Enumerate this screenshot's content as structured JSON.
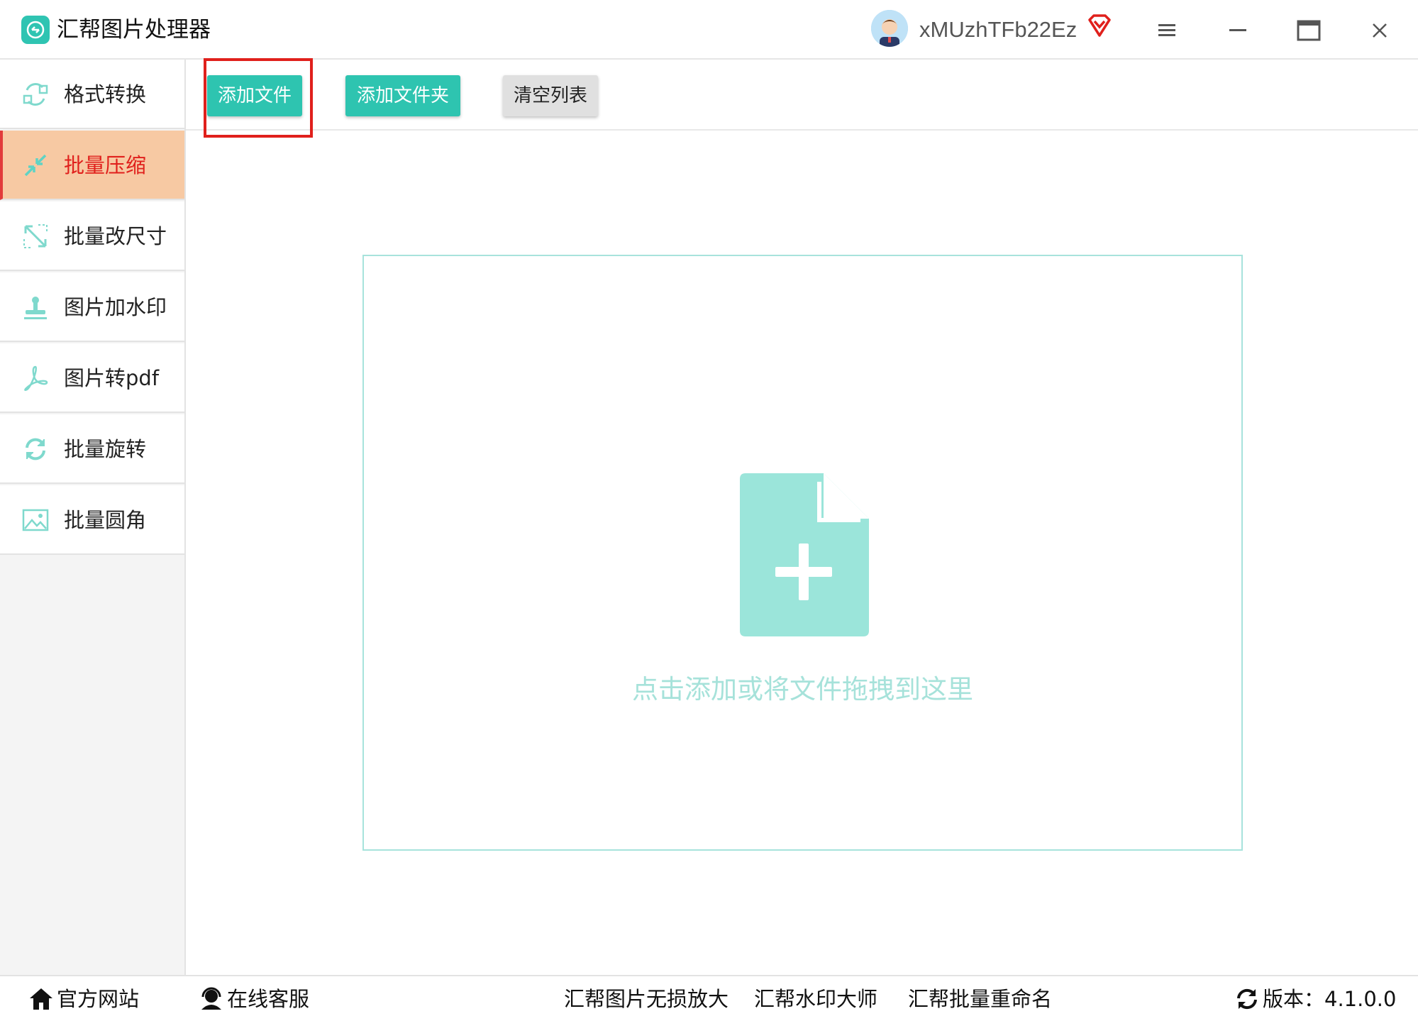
{
  "app": {
    "title": "汇帮图片处理器",
    "username": "xMUzhTFb22Ez"
  },
  "sidebar": {
    "items": [
      {
        "label": "格式转换",
        "icon": "format-convert-icon"
      },
      {
        "label": "批量压缩",
        "icon": "compress-icon",
        "active": true
      },
      {
        "label": "批量改尺寸",
        "icon": "resize-icon"
      },
      {
        "label": "图片加水印",
        "icon": "watermark-icon"
      },
      {
        "label": "图片转pdf",
        "icon": "pdf-icon"
      },
      {
        "label": "批量旋转",
        "icon": "rotate-icon"
      },
      {
        "label": "批量圆角",
        "icon": "round-corner-icon"
      }
    ]
  },
  "toolbar": {
    "add_file": "添加文件",
    "add_folder": "添加文件夹",
    "clear_list": "清空列表"
  },
  "dropzone": {
    "text": "点击添加或将文件拖拽到这里"
  },
  "footer": {
    "website": "官方网站",
    "support": "在线客服",
    "links": [
      "汇帮图片无损放大",
      "汇帮水印大师",
      "汇帮批量重命名"
    ],
    "version": "版本：4.1.0.0"
  },
  "colors": {
    "accent": "#2ec4b0",
    "active_bg": "#f7c9a3",
    "active_text": "#e0201c",
    "drop_icon": "#9be5da"
  }
}
